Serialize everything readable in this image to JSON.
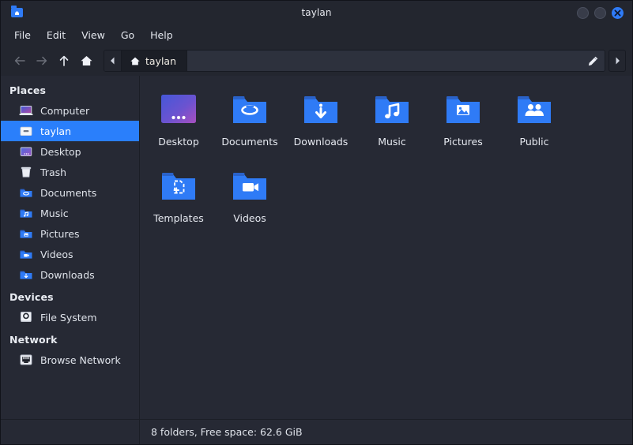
{
  "window": {
    "title": "taylan",
    "app_icon": "home-folder-icon",
    "buttons": [
      {
        "name": "minimize",
        "label": ""
      },
      {
        "name": "maximize",
        "label": ""
      },
      {
        "name": "close",
        "label": "✕"
      }
    ],
    "accent": "#2f7bf6",
    "bg": "#262934",
    "titlebar_bg": "#23262f"
  },
  "menubar": {
    "items": [
      {
        "label": "File"
      },
      {
        "label": "Edit"
      },
      {
        "label": "View"
      },
      {
        "label": "Go"
      },
      {
        "label": "Help"
      }
    ]
  },
  "toolbar": {
    "back": "back-icon",
    "forward": "forward-icon",
    "up": "up-icon",
    "home": "home-icon",
    "path_prev": "◀",
    "path_next": "▶",
    "edit_path": "pencil-icon",
    "breadcrumb": {
      "icon": "home-icon",
      "label": "taylan"
    }
  },
  "sidebar": {
    "sections": [
      {
        "heading": "Places",
        "items": [
          {
            "label": "Computer",
            "icon": "computer-icon",
            "selected": false
          },
          {
            "label": "taylan",
            "icon": "home-icon",
            "selected": true
          },
          {
            "label": "Desktop",
            "icon": "desktop-icon",
            "selected": false
          },
          {
            "label": "Trash",
            "icon": "trash-icon",
            "selected": false
          },
          {
            "label": "Documents",
            "icon": "documents-folder-icon",
            "selected": false
          },
          {
            "label": "Music",
            "icon": "music-folder-icon",
            "selected": false
          },
          {
            "label": "Pictures",
            "icon": "pictures-folder-icon",
            "selected": false
          },
          {
            "label": "Videos",
            "icon": "videos-folder-icon",
            "selected": false
          },
          {
            "label": "Downloads",
            "icon": "downloads-folder-icon",
            "selected": false
          }
        ]
      },
      {
        "heading": "Devices",
        "items": [
          {
            "label": "File System",
            "icon": "harddisk-icon",
            "selected": false
          }
        ]
      },
      {
        "heading": "Network",
        "items": [
          {
            "label": "Browse Network",
            "icon": "network-icon",
            "selected": false
          }
        ]
      }
    ],
    "selection_color": "#2a7ffb"
  },
  "content": {
    "files": [
      {
        "label": "Desktop",
        "icon": "desktop-thumbnail-icon"
      },
      {
        "label": "Documents",
        "icon": "documents-folder-icon"
      },
      {
        "label": "Downloads",
        "icon": "downloads-folder-icon"
      },
      {
        "label": "Music",
        "icon": "music-folder-icon"
      },
      {
        "label": "Pictures",
        "icon": "pictures-folder-icon"
      },
      {
        "label": "Public",
        "icon": "public-folder-icon"
      },
      {
        "label": "Templates",
        "icon": "templates-folder-icon"
      },
      {
        "label": "Videos",
        "icon": "videos-folder-icon"
      }
    ]
  },
  "statusbar": {
    "text": "8 folders, Free space: 62.6 GiB"
  }
}
